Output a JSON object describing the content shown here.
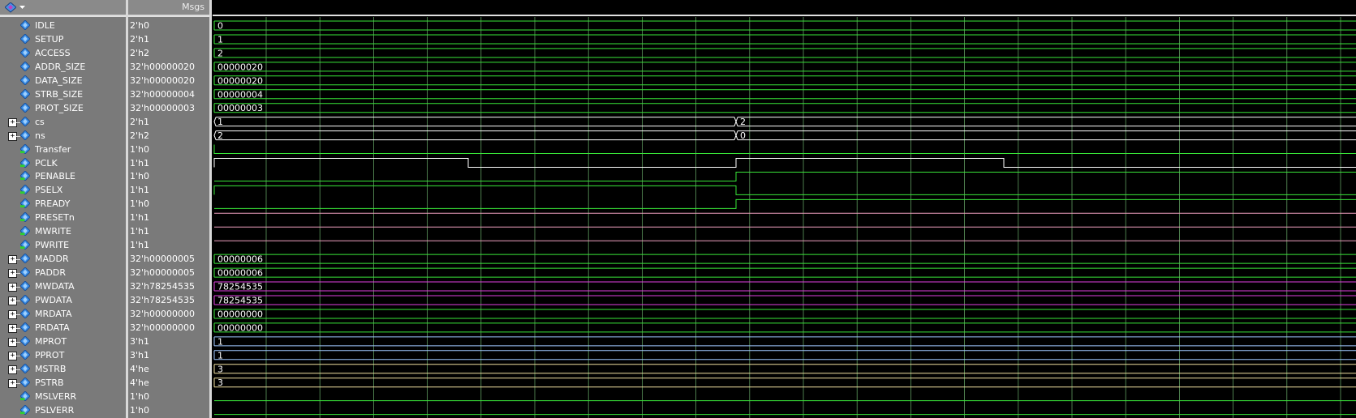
{
  "header": {
    "msgs_label": "Msgs",
    "toolbar_icon": "wave-signal-icon",
    "dropdown_icon": "dropdown-arrow-icon"
  },
  "colors": {
    "green": "#39e639",
    "white": "#ffffff",
    "magenta": "#e040e0",
    "pink": "#f0a0c0",
    "grid": "#a8e0a0",
    "panel": "#7a7a7a"
  },
  "signals": [
    {
      "name": "IDLE",
      "value": "2'h0",
      "wave_text": "0",
      "expandable": false,
      "type": "param"
    },
    {
      "name": "SETUP",
      "value": "2'h1",
      "wave_text": "1",
      "expandable": false,
      "type": "param"
    },
    {
      "name": "ACCESS",
      "value": "2'h2",
      "wave_text": "2",
      "expandable": false,
      "type": "param"
    },
    {
      "name": "ADDR_SIZE",
      "value": "32'h00000020",
      "wave_text": "00000020",
      "expandable": false,
      "type": "param"
    },
    {
      "name": "DATA_SIZE",
      "value": "32'h00000020",
      "wave_text": "00000020",
      "expandable": false,
      "type": "param"
    },
    {
      "name": "STRB_SIZE",
      "value": "32'h00000004",
      "wave_text": "00000004",
      "expandable": false,
      "type": "param"
    },
    {
      "name": "PROT_SIZE",
      "value": "32'h00000003",
      "wave_text": "00000003",
      "expandable": false,
      "type": "param"
    },
    {
      "name": "cs",
      "value": "2'h1",
      "wave_text": "1",
      "wave_text2": "2",
      "expandable": true,
      "type": "bus"
    },
    {
      "name": "ns",
      "value": "2'h2",
      "wave_text": "2",
      "wave_text2": "0",
      "expandable": true,
      "type": "bus"
    },
    {
      "name": "Transfer",
      "value": "1'h0",
      "expandable": false,
      "type": "bit"
    },
    {
      "name": "PCLK",
      "value": "1'h1",
      "expandable": false,
      "type": "bit"
    },
    {
      "name": "PENABLE",
      "value": "1'h0",
      "expandable": false,
      "type": "bit"
    },
    {
      "name": "PSELX",
      "value": "1'h1",
      "expandable": false,
      "type": "bit"
    },
    {
      "name": "PREADY",
      "value": "1'h0",
      "expandable": false,
      "type": "bit"
    },
    {
      "name": "PRESETn",
      "value": "1'h1",
      "expandable": false,
      "type": "bit"
    },
    {
      "name": "MWRITE",
      "value": "1'h1",
      "expandable": false,
      "type": "bit"
    },
    {
      "name": "PWRITE",
      "value": "1'h1",
      "expandable": false,
      "type": "bit"
    },
    {
      "name": "MADDR",
      "value": "32'h00000005",
      "wave_text": "00000006",
      "expandable": true,
      "type": "bus"
    },
    {
      "name": "PADDR",
      "value": "32'h00000005",
      "wave_text": "00000006",
      "expandable": true,
      "type": "bus"
    },
    {
      "name": "MWDATA",
      "value": "32'h78254535",
      "wave_text": "78254535",
      "expandable": true,
      "type": "bus"
    },
    {
      "name": "PWDATA",
      "value": "32'h78254535",
      "wave_text": "78254535",
      "expandable": true,
      "type": "bus"
    },
    {
      "name": "MRDATA",
      "value": "32'h00000000",
      "wave_text": "00000000",
      "expandable": true,
      "type": "bus"
    },
    {
      "name": "PRDATA",
      "value": "32'h00000000",
      "wave_text": "00000000",
      "expandable": true,
      "type": "bus"
    },
    {
      "name": "MPROT",
      "value": "3'h1",
      "wave_text": "1",
      "expandable": true,
      "type": "bus"
    },
    {
      "name": "PPROT",
      "value": "3'h1",
      "wave_text": "1",
      "expandable": true,
      "type": "bus"
    },
    {
      "name": "MSTRB",
      "value": "4'he",
      "wave_text": "3",
      "expandable": true,
      "type": "bus"
    },
    {
      "name": "PSTRB",
      "value": "4'he",
      "wave_text": "3",
      "expandable": true,
      "type": "bus"
    },
    {
      "name": "MSLVERR",
      "value": "1'h0",
      "expandable": false,
      "type": "bit"
    },
    {
      "name": "PSLVERR",
      "value": "1'h0",
      "expandable": false,
      "type": "bit"
    }
  ]
}
